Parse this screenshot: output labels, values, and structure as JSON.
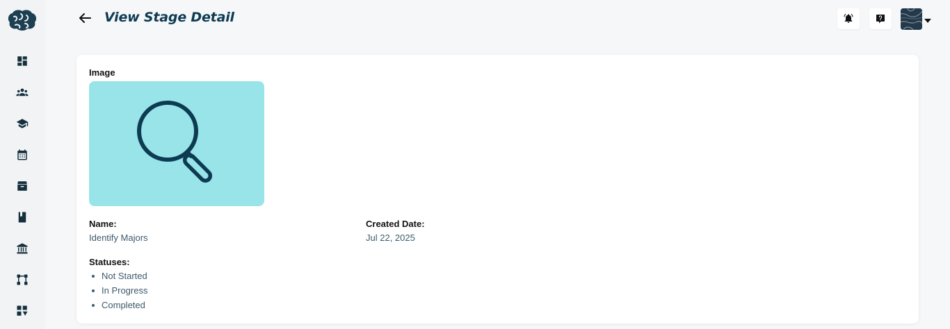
{
  "header": {
    "title": "View Stage Detail"
  },
  "sidebar": {
    "items": [
      {
        "icon": "dashboard-icon"
      },
      {
        "icon": "users-icon"
      },
      {
        "icon": "graduation-cap-icon"
      },
      {
        "icon": "calendar-icon"
      },
      {
        "icon": "archive-box-icon"
      },
      {
        "icon": "book-icon"
      },
      {
        "icon": "institution-icon"
      },
      {
        "icon": "workflow-icon"
      },
      {
        "icon": "grid-dropdown-icon"
      }
    ]
  },
  "detail": {
    "image_label": "Image",
    "image_icon": "magnifying-glass-icon",
    "name_label": "Name:",
    "name_value": "Identify Majors",
    "created_label": "Created Date:",
    "created_value": "Jul 22, 2025",
    "statuses_label": "Statuses:",
    "statuses": [
      "Not Started",
      "In Progress",
      "Completed"
    ]
  },
  "colors": {
    "accent": "#0d3b52",
    "image_bg": "#98e4e8",
    "value_text": "#3d5a6c"
  }
}
